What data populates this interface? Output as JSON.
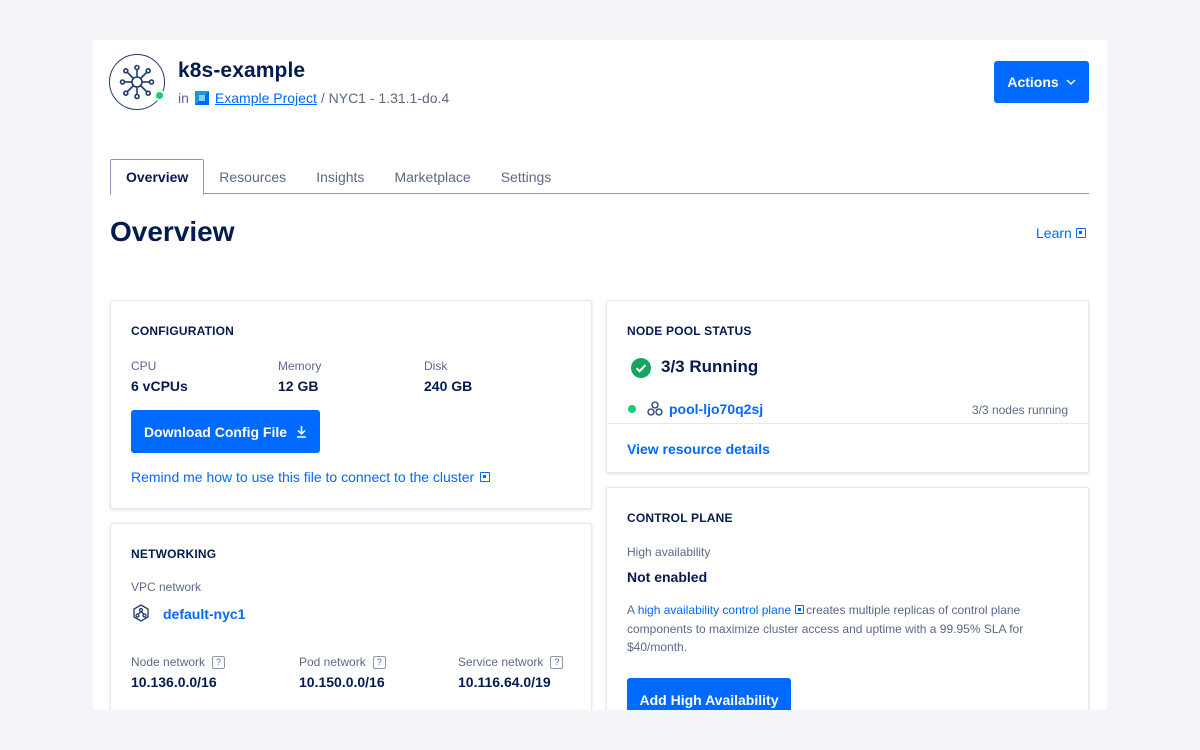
{
  "header": {
    "cluster_name": "k8s-example",
    "in_label": "in",
    "project_name": "Example Project",
    "region_version": "/ NYC1 - 1.31.1-do.4",
    "actions_label": "Actions",
    "status_color": "#15cd72"
  },
  "tabs": [
    {
      "label": "Overview",
      "active": true
    },
    {
      "label": "Resources",
      "active": false
    },
    {
      "label": "Insights",
      "active": false
    },
    {
      "label": "Marketplace",
      "active": false
    },
    {
      "label": "Settings",
      "active": false
    }
  ],
  "page_title": "Overview",
  "learn_label": "Learn",
  "configuration": {
    "title": "CONFIGURATION",
    "cpu_label": "CPU",
    "cpu_value": "6 vCPUs",
    "memory_label": "Memory",
    "memory_value": "12 GB",
    "disk_label": "Disk",
    "disk_value": "240 GB",
    "download_label": "Download Config File",
    "remind_label": "Remind me how to use this file to connect to the cluster"
  },
  "networking": {
    "title": "NETWORKING",
    "vpc_label": "VPC network",
    "vpc_value": "default-nyc1",
    "node_label": "Node network",
    "node_value": "10.136.0.0/16",
    "pod_label": "Pod network",
    "pod_value": "10.150.0.0/16",
    "service_label": "Service network",
    "service_value": "10.116.64.0/19"
  },
  "node_pool": {
    "title": "NODE POOL STATUS",
    "status": "3/3 Running",
    "pool_name": "pool-ljo70q2sj",
    "pool_status": "3/3 nodes running",
    "view_details": "View resource details"
  },
  "control_plane": {
    "title": "CONTROL PLANE",
    "ha_label": "High availability",
    "ha_value": "Not enabled",
    "desc_prefix": "A",
    "desc_link": "high availability control plane",
    "desc_rest": "creates multiple replicas of control plane components to maximize cluster access and uptime with a 99.95% SLA for $40/month.",
    "add_ha_label": "Add High Availability"
  },
  "colors": {
    "accent": "#0069ff",
    "navy": "#031b4e",
    "success": "#15cd72"
  }
}
